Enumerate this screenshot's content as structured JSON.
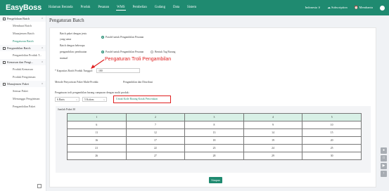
{
  "app": {
    "logo": "EasyBoss"
  },
  "nav": {
    "items": [
      "Halaman Beranda",
      "Produk",
      "Pesanan",
      "WMS",
      "Pembelian",
      "Gudang",
      "Data",
      "Sistem"
    ],
    "active_index": 3
  },
  "topbar": {
    "region": "Indonesia ∨",
    "subscription": "☁ Subscription",
    "reminder": "⏰ Membantu"
  },
  "sidebar": {
    "groups": [
      {
        "label": "Pengelolaan Batch",
        "items": [
          "Membuat Batch",
          "Manajemen Batch",
          "Pengaturan Batch"
        ]
      },
      {
        "label": "Pengambilan Batch",
        "items": [
          "Pengambilan Produk T..."
        ]
      },
      {
        "label": "Kemasan dan Pengi...",
        "items": [
          "Produk Kemasan",
          "Produk Pengiriman"
        ]
      },
      {
        "label": "Manajemen Paket",
        "items": [
          "Semua Paket",
          "Menunggu Pengiriman",
          "Pengambilan Paket"
        ]
      }
    ],
    "active_item": "Pengaturan Batch"
  },
  "page": {
    "title": "Pengaturan Batch"
  },
  "form": {
    "label_batch_same_type_1": "Batch paket dengan jenis",
    "label_batch_same_type_2": "yang sama",
    "option_same_type": "Paralel untuk Pengambilan Pesanan",
    "label_batch_multi_1": "Batch dengan beberapa",
    "label_batch_multi_2": "pengambilan: pembuatan",
    "label_batch_multi_3": "manual",
    "option_multi_parallel": "Paralel untuk Pengambilan Pesanan",
    "option_multi_tag": "Bentuk Tag Barang",
    "label_capacity": "* Kapasitas Batch Produk Tunggal:",
    "capacity_value": "100",
    "label_method": "Metode Penyortiran Paket Multi-Produk:",
    "method_value": "Pengambilan dan Distribusi",
    "label_cart": "Pengaturan troli pengambilan barang campuran dengan multi produk:",
    "rows_value": "6 Baris",
    "cols_value": "5 Kolom",
    "callout_text": "Untuk Kode Barang Kotak Pencetakan",
    "annotation": "Pengaturan Troli Pengambilan",
    "grid_title": "Jumlah Paket:30",
    "save_label": "Simpan"
  },
  "grid": [
    [
      "1",
      "2",
      "3",
      "4",
      "5"
    ],
    [
      "6",
      "7",
      "8",
      "9",
      "10"
    ],
    [
      "11",
      "12",
      "13",
      "14",
      "15"
    ],
    [
      "16",
      "17",
      "18",
      "19",
      "20"
    ],
    [
      "21",
      "22",
      "23",
      "24",
      "25"
    ],
    [
      "26",
      "27",
      "28",
      "29",
      "30"
    ]
  ],
  "colors": {
    "brand": "#1f8a70",
    "alert": "#e02020"
  },
  "float_buttons": [
    "chat-icon",
    "doc-icon",
    "video-icon",
    "top-icon"
  ]
}
